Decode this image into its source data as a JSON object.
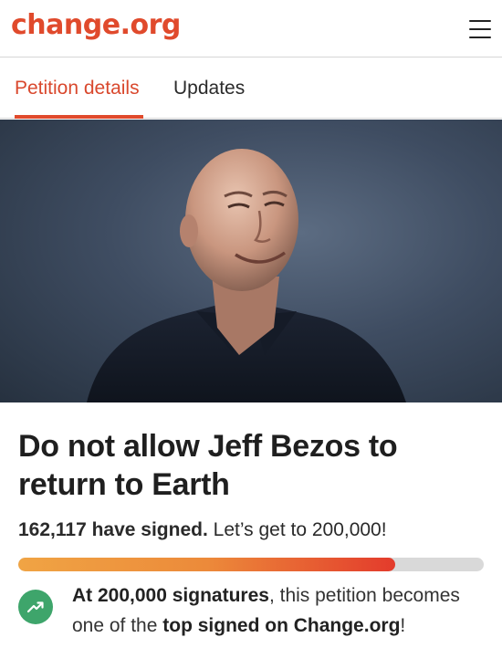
{
  "header": {
    "logo": "change.org",
    "menu_icon": "hamburger-menu-icon"
  },
  "tabs": [
    {
      "label": "Petition details",
      "active": true
    },
    {
      "label": "Updates",
      "active": false
    }
  ],
  "petition": {
    "title": "Do not allow Jeff Bezos to return to Earth",
    "signed_count": "162,117 have signed.",
    "goal_text": "Let’s get to 200,000!",
    "progress_fraction": 0.81,
    "milestone": {
      "part1_bold": "At 200,000 signatures",
      "part2": ", this petition becomes one of the ",
      "part3_bold": "top signed on Change.org",
      "part4": "!"
    }
  },
  "colors": {
    "brand": "#e04a2c",
    "progress_start": "#f0a444",
    "progress_end": "#e33b2c",
    "trend_icon_bg": "#3ea56b"
  }
}
